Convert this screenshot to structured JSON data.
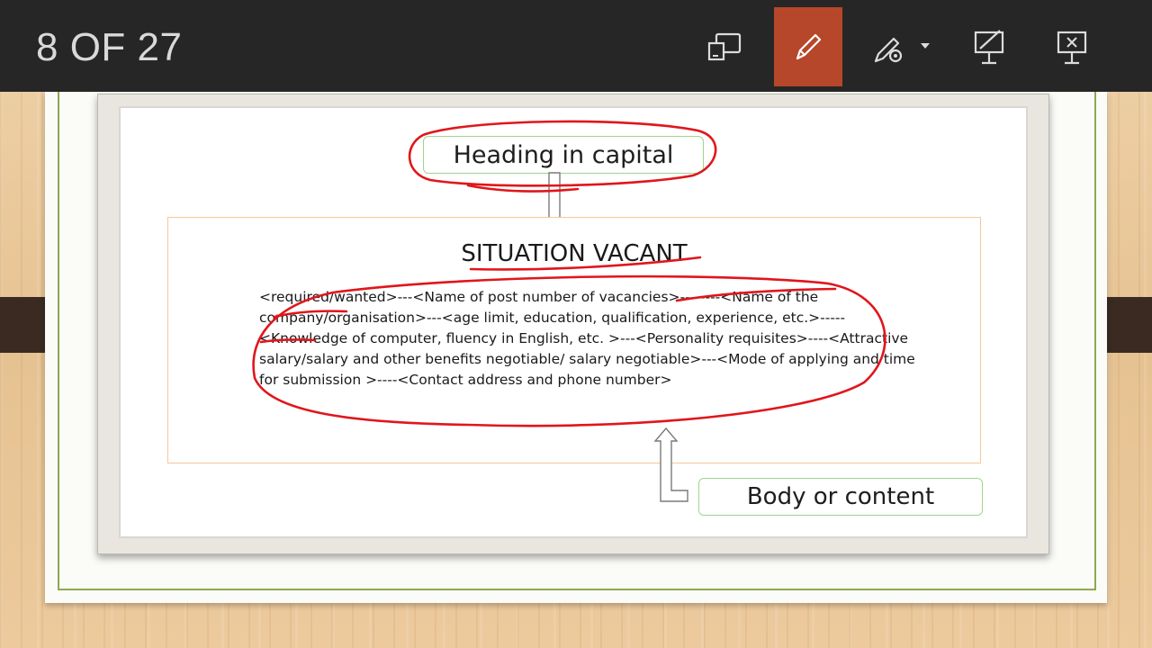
{
  "toolbar": {
    "slide_counter": "8 OF 27",
    "buttons": [
      {
        "name": "cast-icon",
        "active": false
      },
      {
        "name": "pen-icon",
        "active": true
      },
      {
        "name": "ink-settings-icon",
        "active": false
      },
      {
        "name": "laser-pointer-icon",
        "active": false
      },
      {
        "name": "end-show-icon",
        "active": false
      }
    ],
    "active_color": "#b7472a"
  },
  "slide": {
    "heading_label": "Heading in capital",
    "title": "SITUATION VACANT",
    "body_text": "<required/wanted>---<Name of post number of vacancies>--------<Name of the company/organisation>---<age limit, education, qualification, experience, etc.>-----<Knowledge of computer, fluency in English, etc. >---<Personality requisites>----<Attractive salary/salary and other benefits negotiable/ salary negotiable>---<Mode of applying and time for submission >----<Contact address and phone number>",
    "body_label": "Body or content"
  },
  "ink_color": "#e0161b"
}
